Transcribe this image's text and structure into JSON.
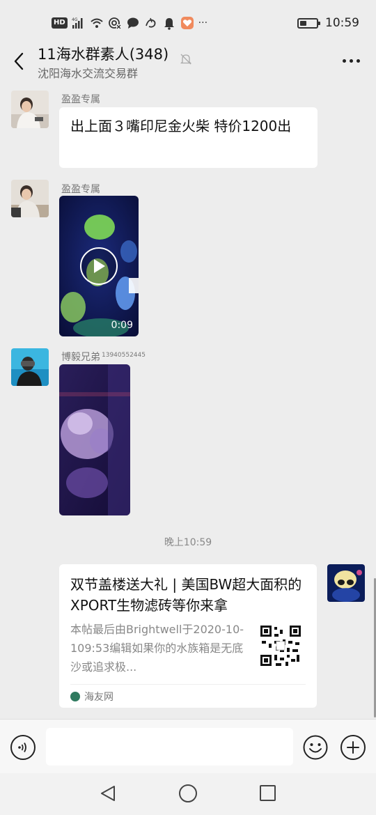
{
  "status_bar": {
    "hd_label": "HD",
    "network_label": "4G",
    "time": "10:59",
    "battery_level": 0.35,
    "icons": [
      "hd-icon",
      "signal-icon",
      "wifi-icon",
      "hotspot-icon",
      "chat-icon",
      "app-icon",
      "bell-icon",
      "heart-app-icon",
      "more-icon",
      "battery-icon"
    ],
    "overflow": "···"
  },
  "header": {
    "title": "11海水群素人(348)",
    "subtitle": "沈阳海水交流交易群"
  },
  "messages": [
    {
      "sender": "盈盈专属",
      "type": "text",
      "text": "出上面３嘴印尼金火柴  特价1200出"
    },
    {
      "sender": "盈盈专属",
      "type": "video",
      "duration": "0:09"
    },
    {
      "sender": "博毅兄弟",
      "sender_number": "13940552445",
      "type": "image"
    }
  ],
  "timestamp": "晚上10:59",
  "link_card": {
    "title": "双节盖楼送大礼 | 美国BW超大面积的XPORT生物滤砖等你来拿",
    "description": "本帖最后由Brightwell于2020-10-109:53编辑如果你的水族箱是无底沙或追求极...",
    "source": "海友网"
  },
  "input_bar": {
    "placeholder": ""
  },
  "colors": {
    "background": "#ededed",
    "bubble": "#ffffff",
    "muted_text": "#888888"
  }
}
